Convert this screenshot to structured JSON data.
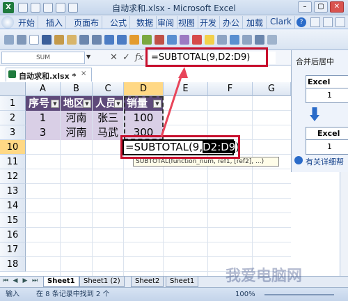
{
  "title_bar": {
    "title": "自动求和.xlsx - Microsoft Excel",
    "min": "–",
    "max": "▢",
    "close": "✕"
  },
  "ribbon_tabs": [
    "开始",
    "插入",
    "页面布",
    "公式",
    "数据",
    "审阅",
    "视图",
    "开发",
    "办公",
    "加载",
    "Clark"
  ],
  "formula_bar": {
    "name_box": "SUM",
    "fx": "fx",
    "cancel": "✕",
    "enter": "✓",
    "content": "=SUBTOTAL(9,D2:D9)"
  },
  "workbook_tab": {
    "name": "自动求和.xlsx *",
    "close": "×"
  },
  "task_pane": {
    "title": "合并后居中",
    "sample1_header": "Excel",
    "sample1_value": "1",
    "sample2_header": "Excel",
    "sample2_value": "1",
    "help": "有关详细帮"
  },
  "sheet": {
    "columns": [
      "A",
      "B",
      "C",
      "D",
      "E",
      "F",
      "G"
    ],
    "rows": [
      "1",
      "2",
      "3",
      "4",
      "5",
      "10",
      "11",
      "12",
      "13",
      "14",
      "15",
      "16",
      "17",
      "18"
    ],
    "headers": [
      "序号",
      "地区",
      "人员",
      "销量"
    ],
    "data": [
      [
        "1",
        "河南",
        "张三",
        "100"
      ],
      [
        "3",
        "河南",
        "马武",
        "300"
      ]
    ],
    "active_cell_prefix": "=SUBTOTAL(9,",
    "active_cell_ref": "D2:D9",
    "active_cell_suffix": ")",
    "tooltip": "SUBTOTAL(function_num, ref1, [ref2], ...)"
  },
  "sheet_tabs": [
    "Sheet1",
    "Sheet1 (2)",
    "Sheet2",
    "Sheet1"
  ],
  "status_bar": {
    "mode": "输入",
    "message": "在 8 条记录中找到 2 个",
    "zoom": "100%"
  },
  "watermark": "我爱电脑网",
  "colors": {
    "header_fill": "#5e4a7a",
    "data_fill": "#d9cfe6",
    "callout": "#c8102e",
    "arrow": "#e8455a"
  }
}
